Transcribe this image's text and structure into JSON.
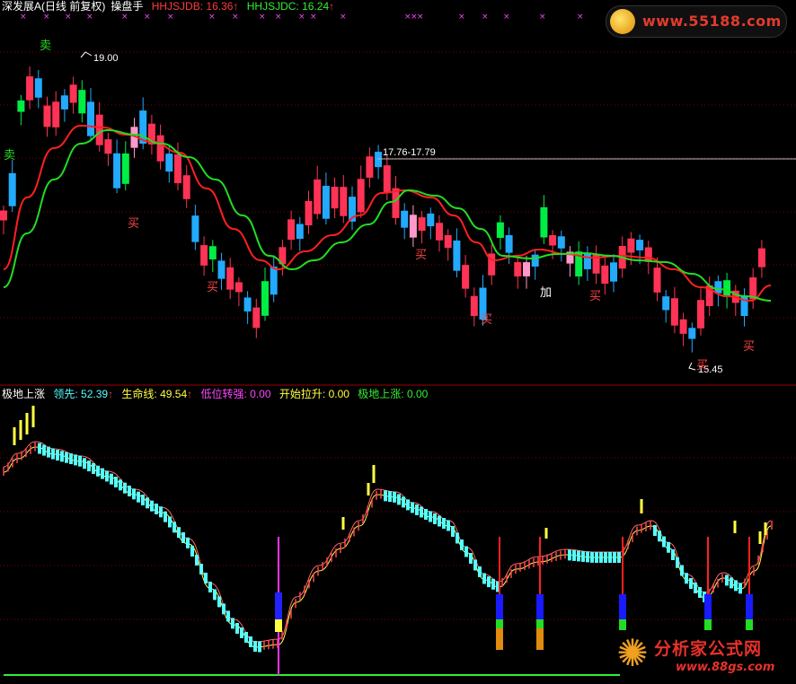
{
  "main_panel": {
    "stock_name": "深发展A",
    "period": "(日线 前复权)",
    "indicator_name": "操盘手",
    "hhjsjdb_label": "HHJSJDB:",
    "hhjsjdb_value": "16.36",
    "hhjsjdc_label": "HHJSJDC:",
    "hhjsjdc_value": "16.24",
    "high_marker": "19.00",
    "range_marker": "17.76-17.79",
    "low_marker": "15.45",
    "signals": [
      {
        "text": "卖",
        "kind": "sell"
      },
      {
        "text": "卖",
        "kind": "sell"
      },
      {
        "text": "买",
        "kind": "buy"
      },
      {
        "text": "买",
        "kind": "buy"
      },
      {
        "text": "买",
        "kind": "buy"
      },
      {
        "text": "买",
        "kind": "buy"
      },
      {
        "text": "加",
        "kind": "add"
      },
      {
        "text": "买",
        "kind": "buy"
      },
      {
        "text": "买",
        "kind": "buy"
      },
      {
        "text": "买",
        "kind": "buy"
      }
    ],
    "x_marks": "×",
    "arrow_up": "↑"
  },
  "sub_panel": {
    "name": "极地上涨",
    "leader_label": "领先:",
    "leader_value": "52.39",
    "lifeline_label": "生命线:",
    "lifeline_value": "49.54",
    "low_strong_label": "低位转强:",
    "low_strong_value": "0.00",
    "start_pull_label": "开始拉升:",
    "start_pull_value": "0.00",
    "polar_rise_label": "极地上涨:",
    "polar_rise_value": "0.00",
    "arrow_up": "↑"
  },
  "watermarks": {
    "top_site": "www.55188.com",
    "bottom_title": "分析家公式网",
    "bottom_site": "www.88gs.com"
  },
  "colors": {
    "background": "#000000",
    "up_candle": "#ff3355",
    "down_candle": "#22aaff",
    "highlight_green": "#00ee44",
    "highlight_pink": "#ff99cc",
    "ma_red": "#ff2020",
    "ma_green": "#22dd22",
    "leader_yellow": "#ffff40",
    "cyan_bar": "#55ffff",
    "magenta": "#ff33ff",
    "grid": "#800000"
  }
}
